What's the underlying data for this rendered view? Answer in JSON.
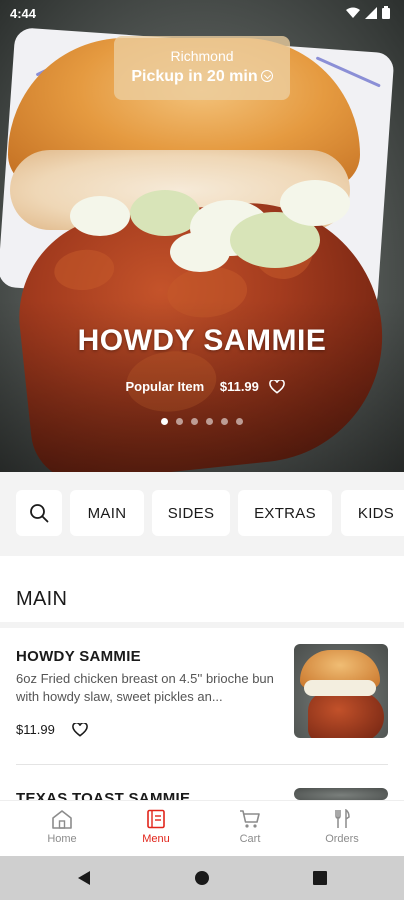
{
  "status_bar": {
    "time": "4:44"
  },
  "hero": {
    "location": "Richmond",
    "pickup_text": "Pickup in 20 min",
    "title": "HOWDY SAMMIE",
    "tag": "Popular Item",
    "price": "$11.99",
    "carousel": {
      "total": 6,
      "active": 1
    }
  },
  "categories": {
    "search_icon": "search-icon",
    "items": [
      "MAIN",
      "SIDES",
      "EXTRAS",
      "KIDS"
    ]
  },
  "section": {
    "title": "MAIN"
  },
  "menu_items": [
    {
      "name": "HOWDY SAMMIE",
      "description": "6oz Fried chicken breast on 4.5'' brioche bun with howdy slaw, sweet pickles an...",
      "price": "$11.99"
    },
    {
      "name": "TEXAS TOAST SAMMIE"
    }
  ],
  "bottom_nav": {
    "active": "Menu",
    "tabs": [
      {
        "label": "Home",
        "icon": "home-icon"
      },
      {
        "label": "Menu",
        "icon": "menu-book-icon"
      },
      {
        "label": "Cart",
        "icon": "cart-icon"
      },
      {
        "label": "Orders",
        "icon": "fork-knife-icon"
      }
    ]
  },
  "colors": {
    "accent": "#e1251b",
    "chip_bg": "#ffffff",
    "bar_bg": "#f3f3f3"
  }
}
